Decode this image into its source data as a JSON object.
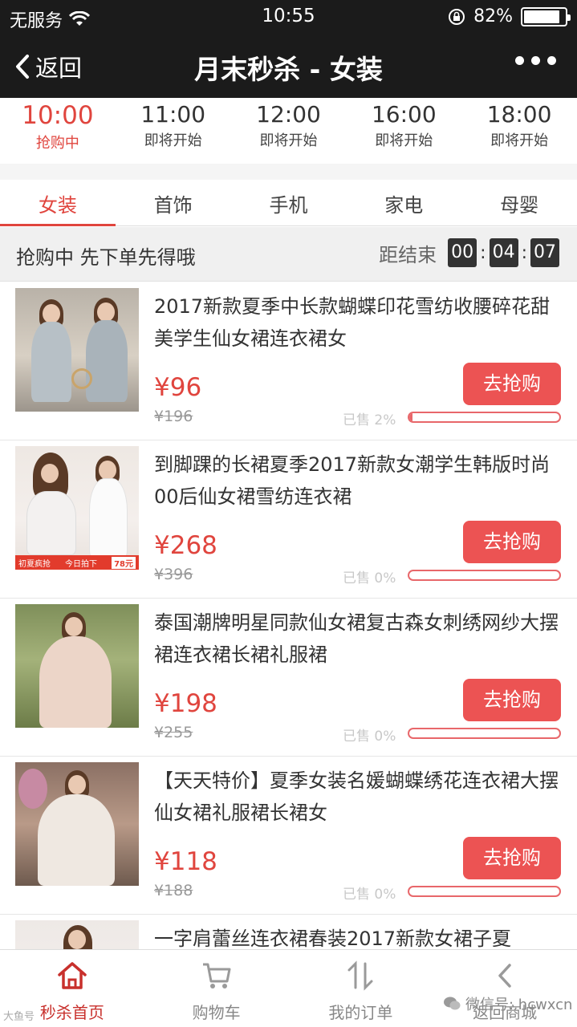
{
  "status_bar": {
    "carrier": "无服务",
    "time": "10:55",
    "battery": "82%"
  },
  "nav": {
    "back_label": "返回",
    "title": "月末秒杀 - 女装"
  },
  "time_slots": [
    {
      "time": "10:00",
      "status": "抢购中",
      "active": true
    },
    {
      "time": "11:00",
      "status": "即将开始",
      "active": false
    },
    {
      "time": "12:00",
      "status": "即将开始",
      "active": false
    },
    {
      "time": "16:00",
      "status": "即将开始",
      "active": false
    },
    {
      "time": "18:00",
      "status": "即将开始",
      "active": false
    }
  ],
  "categories": [
    {
      "label": "女装",
      "active": true
    },
    {
      "label": "首饰",
      "active": false
    },
    {
      "label": "手机",
      "active": false
    },
    {
      "label": "家电",
      "active": false
    },
    {
      "label": "母婴",
      "active": false
    }
  ],
  "countdown": {
    "message": "抢购中 先下单先得哦",
    "end_label": "距结束",
    "hours": "00",
    "minutes": "04",
    "seconds": "07"
  },
  "products": [
    {
      "name": "2017新款夏季中长款蝴蝶印花雪纺收腰碎花甜美学生仙女裙连衣裙女",
      "price": "¥96",
      "original_price": "¥196",
      "sold_text": "已售 2%",
      "sold_fraction": 0.02,
      "buy_label": "去抢购"
    },
    {
      "name": "到脚踝的长裙夏季2017新款女潮学生韩版时尚00后仙女裙雪纺连衣裙",
      "price": "¥268",
      "original_price": "¥396",
      "sold_text": "已售 0%",
      "sold_fraction": 0,
      "buy_label": "去抢购",
      "promo": {
        "left": "初夏疯抢",
        "mid": "今日拍下",
        "price": "78元"
      }
    },
    {
      "name": "泰国潮牌明星同款仙女裙复古森女刺绣网纱大摆裙连衣裙长裙礼服裙",
      "price": "¥198",
      "original_price": "¥255",
      "sold_text": "已售 0%",
      "sold_fraction": 0,
      "buy_label": "去抢购"
    },
    {
      "name": "【天天特价】夏季女装名媛蝴蝶绣花连衣裙大摆仙女裙礼服裙长裙女",
      "price": "¥118",
      "original_price": "¥188",
      "sold_text": "已售 0%",
      "sold_fraction": 0,
      "buy_label": "去抢购"
    },
    {
      "name": "一字肩蕾丝连衣裙春装2017新款女裙子夏"
    }
  ],
  "tabbar": [
    {
      "label": "秒杀首页",
      "icon": "home-icon",
      "active": true
    },
    {
      "label": "购物车",
      "icon": "cart-icon",
      "active": false
    },
    {
      "label": "我的订单",
      "icon": "order-icon",
      "active": false
    },
    {
      "label": "返回商城",
      "icon": "back-chevron-icon",
      "active": false
    }
  ],
  "watermarks": {
    "left": "大鱼号",
    "right": "微信号: hcwxcn"
  },
  "colors": {
    "accent": "#e0453e",
    "button": "#ec5353",
    "topbar": "#1b1b1b"
  }
}
